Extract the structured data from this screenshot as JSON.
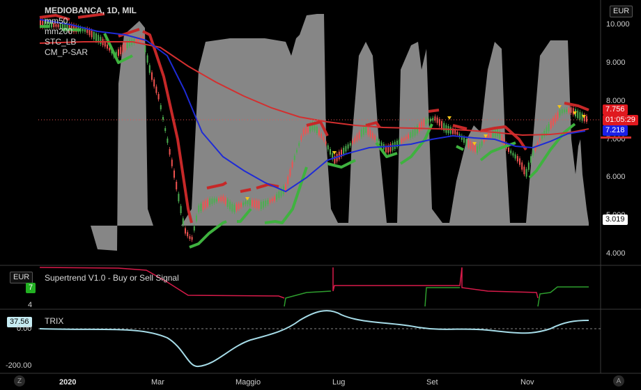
{
  "main_pane": {
    "title": "MEDIOBANCA, 1D, MIL",
    "indicators": [
      "mm50",
      "mm200",
      "STC_LB",
      "CM_P-SAR"
    ],
    "currency_button": "EUR",
    "y_ticks": [
      "10.000",
      "9.000",
      "8.000",
      "7.000",
      "6.000",
      "5.000",
      "4.000"
    ],
    "price_tags": {
      "last_price": "7.756",
      "countdown": "01:05:29",
      "mm50": "7.218",
      "stc": "3.019"
    }
  },
  "supertrend_pane": {
    "label": "Supertrend V1.0 - Buy or Sell Signal",
    "currency_button": "EUR",
    "value_tag": "7",
    "y_tick": "4"
  },
  "trix_pane": {
    "label": "TRIX",
    "value_tag": "37.56",
    "y_ticks": [
      "0.00",
      "-200.00"
    ]
  },
  "x_axis": {
    "labels": [
      "2020",
      "Mar",
      "Maggio",
      "Lug",
      "Set",
      "Nov"
    ]
  },
  "corner_buttons": {
    "left": "Z",
    "right": "A"
  },
  "colors": {
    "background": "#000000",
    "up_candle": "#4caf50",
    "down_candle": "#ef5350",
    "mm50": "#1e2bd6",
    "mm200": "#d32f2f",
    "sar_up": "#3fb23f",
    "sar_down": "#c62828",
    "stc_fill": "#9e9e9e",
    "trix": "#a6dce8",
    "supertrend_down": "#d81b4a",
    "supertrend_up": "#2e9e2e"
  }
}
